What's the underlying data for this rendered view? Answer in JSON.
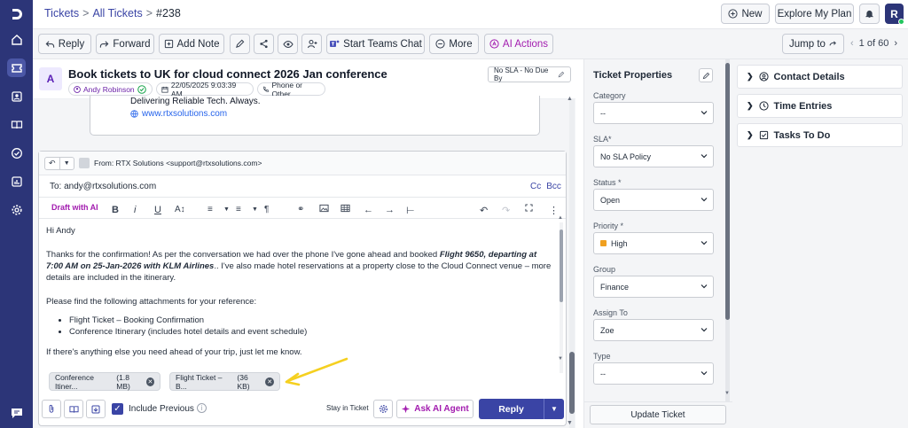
{
  "nav": {
    "items": [
      "home-icon",
      "tickets-icon",
      "contacts-icon",
      "knowledge-base-icon",
      "tasks-icon",
      "reports-icon",
      "settings-icon"
    ],
    "active": "tickets-icon",
    "chat": "chat-icon"
  },
  "topbar": {
    "breadcrumb": {
      "tickets": "Tickets",
      "sep1": ">",
      "all_tickets": "All Tickets",
      "sep2": ">",
      "ticket_id": "#238"
    },
    "new_label": "New",
    "explore_label": "Explore My Plan",
    "avatar_letter": "R"
  },
  "toolbar": {
    "reply": "Reply",
    "forward": "Forward",
    "add_note": "Add Note",
    "teams": "Start Teams Chat",
    "more": "More",
    "ai_actions": "AI Actions",
    "jump_to": "Jump to",
    "pager": "1 of 60"
  },
  "ticket": {
    "avatar_letter": "A",
    "title": "Book tickets to UK for cloud connect 2026 Jan conference",
    "requester": "Andy Robinson",
    "date": "22/05/2025 9:03:39 AM",
    "source": "Phone or Other",
    "sla": "No SLA - No Due By"
  },
  "previous_message": {
    "tagline": "Delivering Reliable Tech. Always.",
    "website": "www.rtxsolutions.com"
  },
  "reply_editor": {
    "from": "From:  RTX Solutions <support@rtxsolutions.com>",
    "to": "To: andy@rtxsolutions.com",
    "cc": "Cc",
    "bcc": "Bcc",
    "draft_ai": "Draft with AI",
    "greeting": "Hi Andy",
    "para1_a": "Thanks for the confirmation! As per the conversation we had over the phone I've gone ahead and booked ",
    "para1_bold": "Flight 9650, departing at 7:00 AM on 25-Jan-2026 with KLM Airlines",
    "para1_b": ".. I've also made hotel reservations at a property close to the Cloud Connect venue – more details are included in the itinerary.",
    "para2": "Please find the following attachments for your reference:",
    "bullets": [
      "Flight Ticket – Booking Confirmation",
      "Conference Itinerary (includes hotel details and event schedule)"
    ],
    "para3": "If there's anything else you need ahead of your trip, just let me know.",
    "attachments": [
      {
        "name": "Conference Itiner...",
        "size": "(1.8 MB)"
      },
      {
        "name": "Flight Ticket – B...",
        "size": "(36 KB)"
      }
    ],
    "include_previous": "Include Previous",
    "include_previous_checked": true,
    "stay_in_ticket": "Stay in Ticket",
    "ask_ai_agent": "Ask AI Agent",
    "reply_button": "Reply"
  },
  "properties": {
    "title": "Ticket Properties",
    "fields": [
      {
        "label": "Category",
        "value": "--"
      },
      {
        "label": "SLA*",
        "value": "No SLA Policy"
      },
      {
        "label": "Status *",
        "value": "Open"
      },
      {
        "label": "Priority *",
        "value": "High"
      },
      {
        "label": "Group",
        "value": "Finance"
      },
      {
        "label": "Assign To",
        "value": "Zoe"
      },
      {
        "label": "Type",
        "value": "--"
      }
    ],
    "update_button": "Update Ticket"
  },
  "right_panels": {
    "contact": "Contact Details",
    "time": "Time Entries",
    "tasks": "Tasks To Do"
  },
  "colors": {
    "nav_bg": "#2c3578",
    "accent": "#3a44a5",
    "ai_purple": "#a21caf",
    "priority_high": "#f0a020",
    "annotation_arrow": "#f5d020"
  }
}
